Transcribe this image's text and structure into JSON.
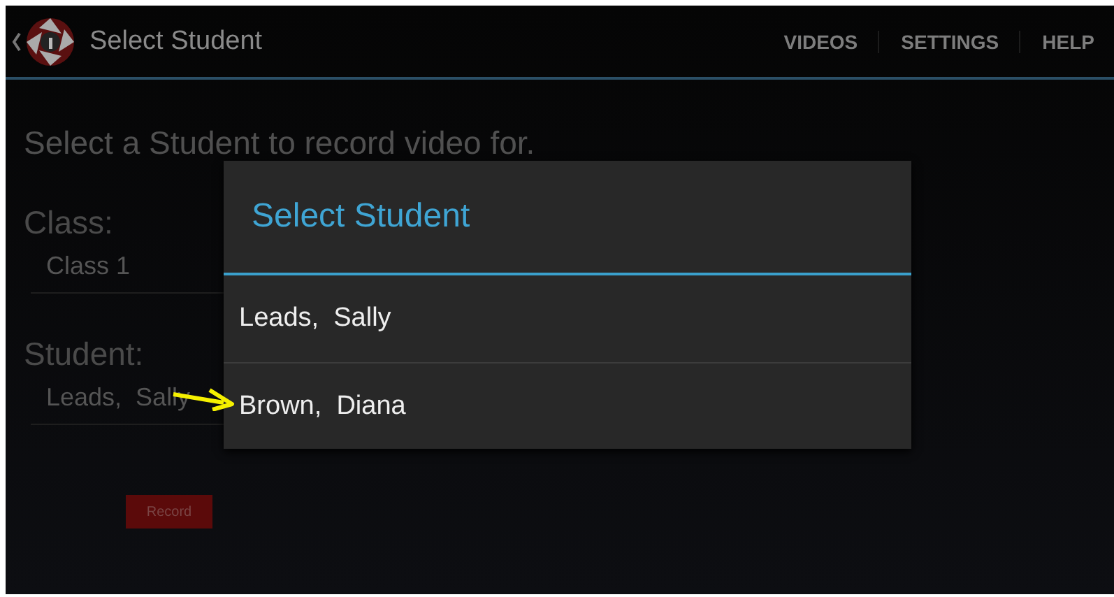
{
  "action_bar": {
    "title": "Select Student",
    "actions": [
      "VIDEOS",
      "SETTINGS",
      "HELP"
    ]
  },
  "form": {
    "heading": "Select a Student to record video for.",
    "class_label": "Class:",
    "class_value": "Class 1",
    "student_label": "Student:",
    "student_value": "Leads,  Sally",
    "record_button": "Record"
  },
  "dialog": {
    "title": "Select Student",
    "items": [
      {
        "label": "Leads,  Sally"
      },
      {
        "label": "Brown,  Diana"
      }
    ]
  }
}
